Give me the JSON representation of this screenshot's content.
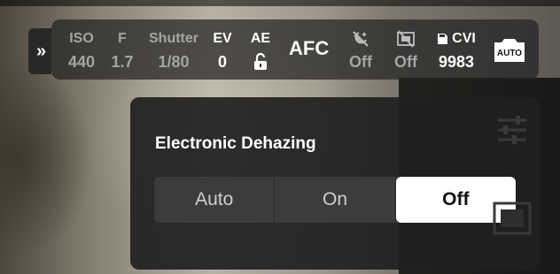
{
  "toolbar": {
    "expand_icon": "double-chevron-right-icon",
    "iso": {
      "label": "ISO",
      "value": "440"
    },
    "aperture": {
      "label": "F",
      "value": "1.7"
    },
    "shutter": {
      "label": "Shutter",
      "value": "1/80"
    },
    "ev": {
      "label": "EV",
      "value": "0"
    },
    "ae": {
      "label": "AE",
      "icon": "unlock-icon"
    },
    "focus_mode": "AFC",
    "dehaze_status": {
      "icon": "dehaze-off-icon",
      "value": "Off"
    },
    "overlay_status": {
      "icon": "overlay-off-icon",
      "value": "Off"
    },
    "storage": {
      "icon": "sd-card-icon",
      "label": "CVI",
      "value": "9983"
    },
    "camera_mode": {
      "icon": "camera-auto-icon",
      "badge": "AUTO"
    }
  },
  "panel": {
    "title": "Electronic Dehazing",
    "options": [
      "Auto",
      "On",
      "Off"
    ],
    "selected": "Off",
    "side_icons": [
      "sliders-icon",
      "frame-icon"
    ]
  },
  "colors": {
    "accent": "#ffffff",
    "muted": "#a5a5a5",
    "panel": "#202020"
  }
}
